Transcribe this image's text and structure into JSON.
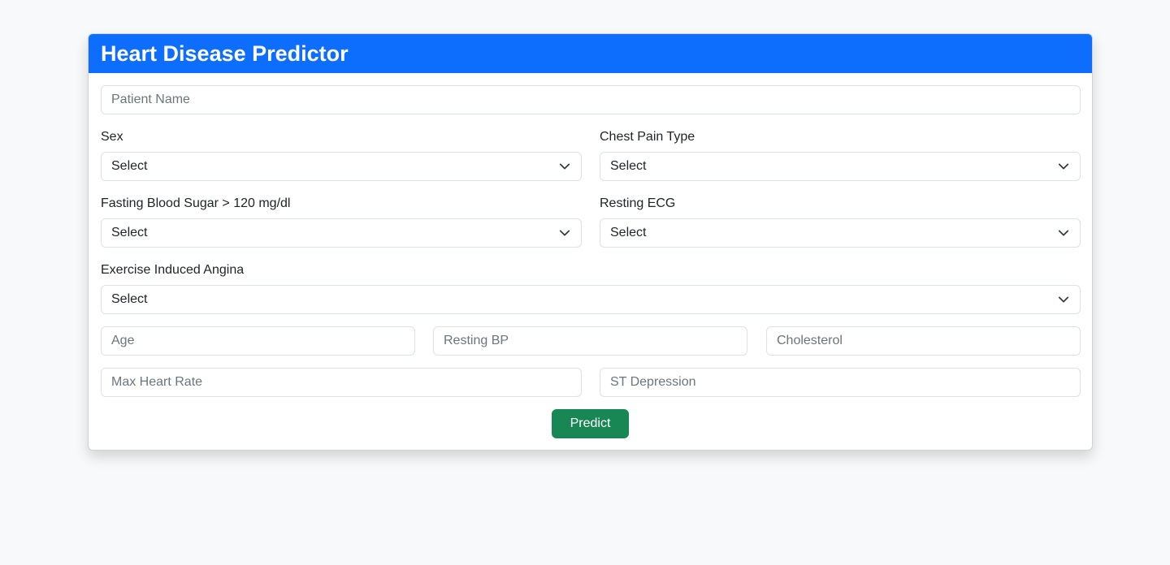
{
  "header": {
    "title": "Heart Disease Predictor"
  },
  "form": {
    "patient_name": {
      "placeholder": "Patient Name",
      "value": ""
    },
    "sex": {
      "label": "Sex",
      "selected": "Select"
    },
    "chest_pain_type": {
      "label": "Chest Pain Type",
      "selected": "Select"
    },
    "fasting_blood_sugar": {
      "label": "Fasting Blood Sugar > 120 mg/dl",
      "selected": "Select"
    },
    "resting_ecg": {
      "label": "Resting ECG",
      "selected": "Select"
    },
    "exercise_induced_angina": {
      "label": "Exercise Induced Angina",
      "selected": "Select"
    },
    "age": {
      "placeholder": "Age",
      "value": ""
    },
    "resting_bp": {
      "placeholder": "Resting BP",
      "value": ""
    },
    "cholesterol": {
      "placeholder": "Cholesterol",
      "value": ""
    },
    "max_heart_rate": {
      "placeholder": "Max Heart Rate",
      "value": ""
    },
    "st_depression": {
      "placeholder": "ST Depression",
      "value": ""
    },
    "submit_label": "Predict"
  },
  "colors": {
    "header_bg": "#0d6efd",
    "button_bg": "#198754",
    "page_bg": "#f8f9fa"
  }
}
